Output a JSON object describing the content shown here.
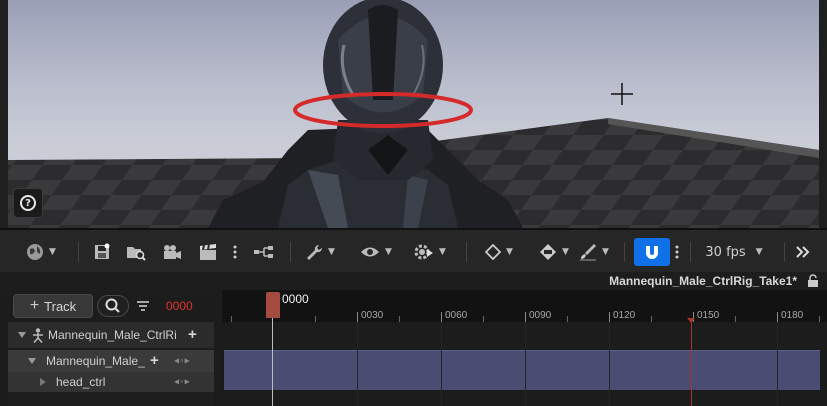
{
  "viewport": {
    "help_icon": "question-circle-icon"
  },
  "toolbar": {
    "fps_label": "30 fps",
    "icons": [
      "globe-icon",
      "save-icon",
      "browse-icon",
      "camera-icon",
      "clapper-icon",
      "more-icon",
      "hierarchy-icon",
      "wrench-icon",
      "eye-icon",
      "gear-icon",
      "key-diamond-icon",
      "key-fill-icon",
      "paint-icon",
      "magnet-icon",
      "more-icon",
      "chevrons-right-icon"
    ],
    "snap_accent": "#0f70e8"
  },
  "sequence": {
    "name": "Mannequin_Male_CtrlRig_Take1*"
  },
  "outliner": {
    "add_track_label": "Track",
    "current_frame": "0000",
    "frame_color": "#e0342a",
    "rows": [
      {
        "label": "Mannequin_Male_CtrlRi"
      },
      {
        "label": "Mannequin_Male_"
      },
      {
        "label": "head_ctrl"
      }
    ]
  },
  "timeline": {
    "current_label": "0000",
    "ticks": [
      "0030",
      "0060",
      "0090",
      "0120",
      "0150",
      "0180"
    ],
    "playhead_color": "#a34b3f",
    "section_color": "#4a4c74"
  }
}
